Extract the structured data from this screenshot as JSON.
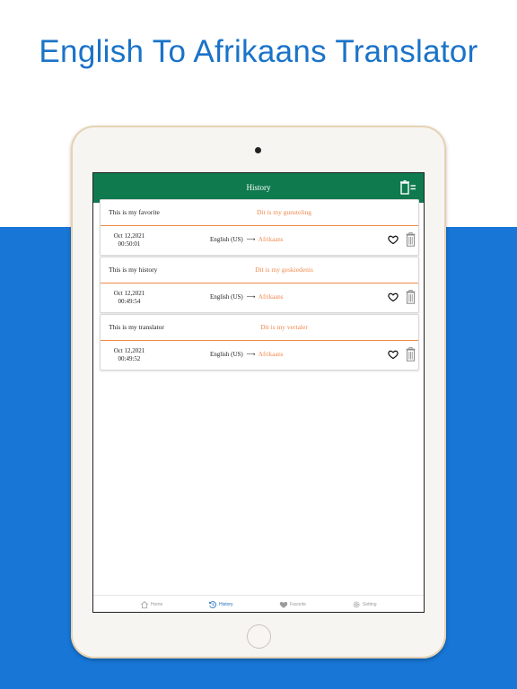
{
  "promo": {
    "title": "English To Afrikaans Translator"
  },
  "app": {
    "header_title": "History",
    "colors": {
      "header": "#0f7a4e",
      "accent": "#f08a50",
      "promo_blue": "#1776d6",
      "nav_active": "#1f6fbf"
    },
    "history": [
      {
        "source": "This is my favorite",
        "translation": "Dit is my gunsteling",
        "date": "Oct 12,2021",
        "time": "00:50:01",
        "from_lang": "English (US)",
        "arrow": "⟶",
        "to_lang": "Afrikaans"
      },
      {
        "source": "This is my history",
        "translation": "Dit is my geskiedenis",
        "date": "Oct 12,2021",
        "time": "00:49:54",
        "from_lang": "English (US)",
        "arrow": "⟶",
        "to_lang": "Afrikaans"
      },
      {
        "source": "This is my translator",
        "translation": "Dit is my vertaler",
        "date": "Oct 12,2021",
        "time": "00:49:52",
        "from_lang": "English (US)",
        "arrow": "⟶",
        "to_lang": "Afrikaans"
      }
    ],
    "nav": [
      {
        "label": "Home",
        "icon": "home-icon"
      },
      {
        "label": "History",
        "icon": "history-icon"
      },
      {
        "label": "Favorite",
        "icon": "heart-icon"
      },
      {
        "label": "Setting",
        "icon": "gear-icon"
      }
    ]
  }
}
